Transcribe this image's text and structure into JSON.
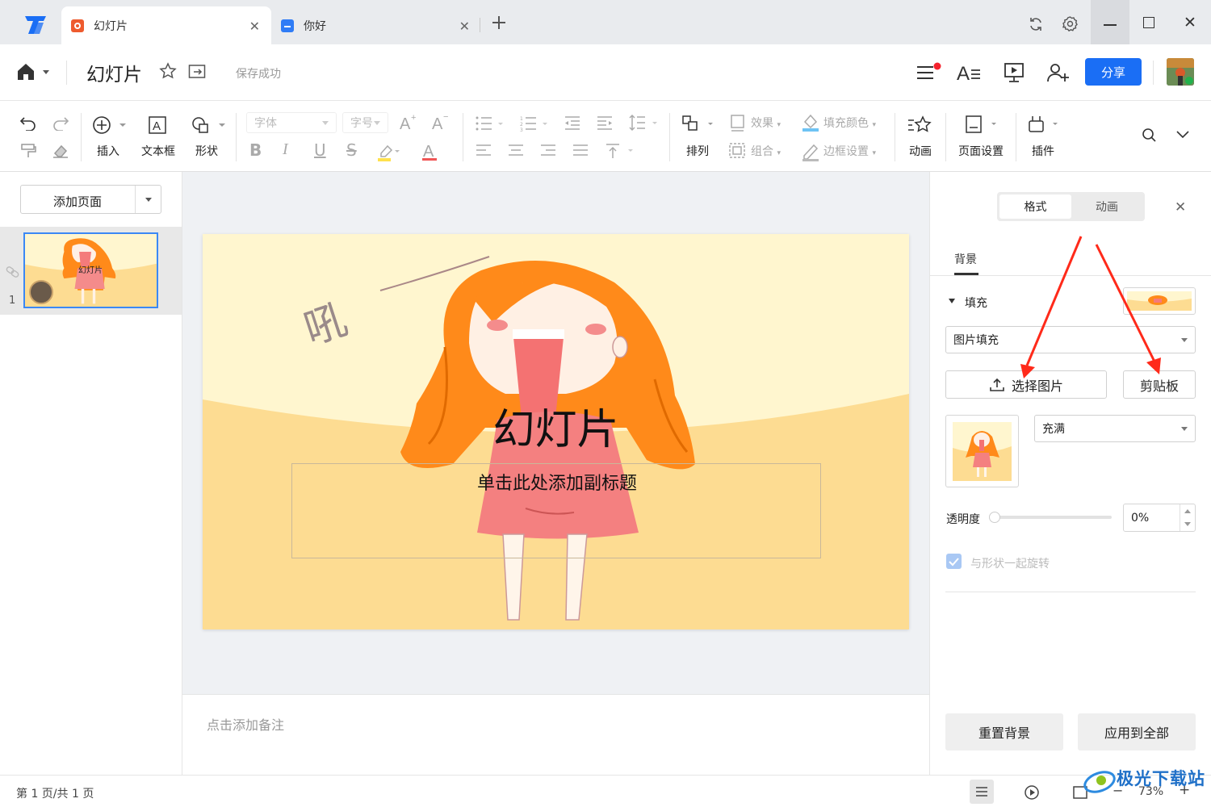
{
  "tabs": [
    {
      "label": "幻灯片",
      "icon": "presentation-doc-icon",
      "color": "#ee5b2e"
    },
    {
      "label": "你好",
      "icon": "text-doc-icon",
      "color": "#2f7cf6"
    }
  ],
  "header": {
    "doc_title": "幻灯片",
    "save_status": "保存成功",
    "share_label": "分享"
  },
  "toolbar": {
    "insert": "插入",
    "textbox": "文本框",
    "shape": "形状",
    "font_placeholder": "字体",
    "size_placeholder": "字号",
    "arrange": "排列",
    "effect": "效果",
    "group": "组合",
    "fill_color": "填充颜色",
    "border": "边框设置",
    "animation": "动画",
    "page_setup": "页面设置",
    "plugin": "插件"
  },
  "left_panel": {
    "add_page": "添加页面",
    "thumb_number": "1",
    "thumb_title": "幻灯片"
  },
  "slide": {
    "title": "幻灯片",
    "subtitle": "单击此处添加副标题",
    "doodle": "吼"
  },
  "notes_placeholder": "点击添加备注",
  "right_panel": {
    "tab_format": "格式",
    "tab_animation": "动画",
    "section": "背景",
    "fill_label": "填充",
    "fill_type": "图片填充",
    "choose_image": "选择图片",
    "clipboard": "剪贴板",
    "fit_mode": "充满",
    "transparency_label": "透明度",
    "transparency_value": "0%",
    "rotate_with_shape": "与形状一起旋转",
    "reset_bg": "重置背景",
    "apply_all": "应用到全部"
  },
  "status": {
    "page_info": "第 1 页/共 1 页",
    "zoom": "73%"
  },
  "watermark": "极光下载站",
  "colors": {
    "accent": "#1a6ef5",
    "arrow": "#ff2a1a",
    "slide_bg_top": "#fff6cf",
    "slide_bg_bottom": "#fddc92",
    "hair": "#ff8a1a"
  }
}
